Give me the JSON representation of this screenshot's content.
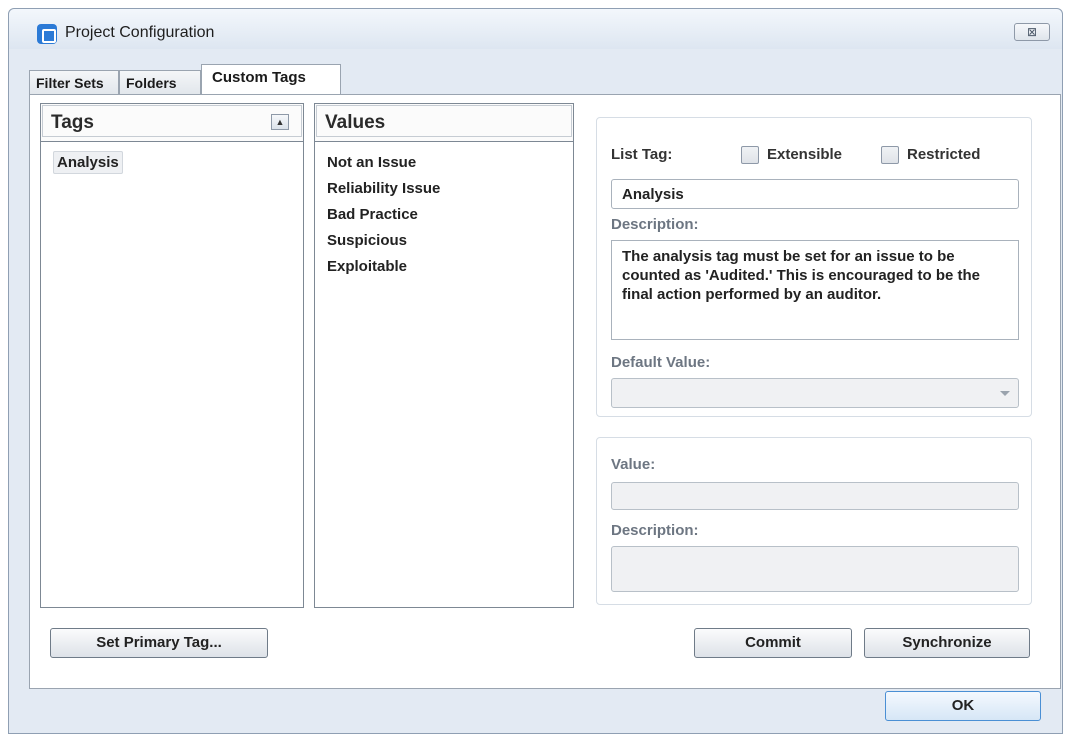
{
  "window": {
    "title": "Project Configuration",
    "close_glyph": "⊠",
    "app_icon": "app-icon"
  },
  "tabs": [
    {
      "label": "Filter Sets",
      "active": false
    },
    {
      "label": "Folders",
      "active": false
    },
    {
      "label": "Custom Tags",
      "active": true
    }
  ],
  "tags_panel": {
    "header": "Tags",
    "sort_icon": "sort-icon",
    "items": [
      {
        "label": "Analysis",
        "selected": true
      }
    ]
  },
  "values_panel": {
    "header": "Values",
    "items": [
      {
        "label": "Not an Issue"
      },
      {
        "label": "Reliability Issue"
      },
      {
        "label": "Bad Practice"
      },
      {
        "label": "Suspicious"
      },
      {
        "label": "Exploitable"
      }
    ]
  },
  "tag_details": {
    "list_tag_label": "List Tag:",
    "extensible_label": "Extensible",
    "restricted_label": "Restricted",
    "name_value": "Analysis",
    "description_label": "Description:",
    "description_value": "The analysis tag must be set for an issue to be counted as 'Audited.' This is encouraged to be the final action performed by an auditor.",
    "default_value_label": "Default Value:",
    "default_value": ""
  },
  "value_details": {
    "value_label": "Value:",
    "value": "",
    "description_label": "Description:",
    "description_value": ""
  },
  "buttons": {
    "set_primary_tag": "Set Primary Tag...",
    "commit": "Commit",
    "synchronize": "Synchronize",
    "ok": "OK"
  }
}
